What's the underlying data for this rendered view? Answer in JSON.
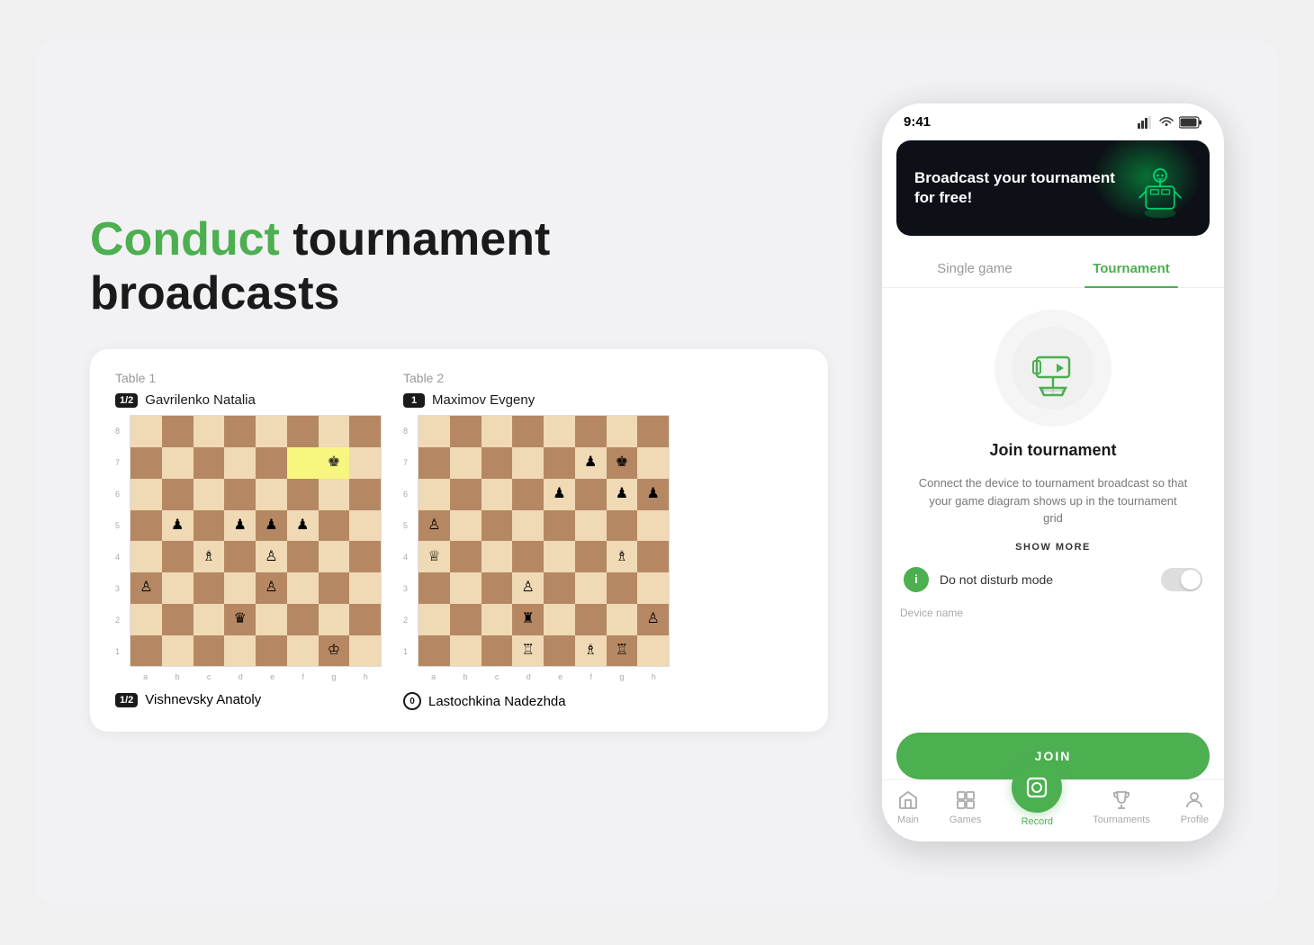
{
  "headline": {
    "green": "Conduct",
    "rest": " tournament\nbroadcasts"
  },
  "table1": {
    "label": "Table 1",
    "player1": {
      "badge": "1/2",
      "name": "Gavrilenko Natalia"
    },
    "player2": {
      "badge": "1/2",
      "name": "Vishnevsky Anatoly"
    }
  },
  "table2": {
    "label": "Table 2",
    "player1": {
      "badge": "1",
      "name": "Maximov Evgeny"
    },
    "player2": {
      "badge_type": "circle",
      "badge": "0",
      "name": "Lastochkina Nadezhda"
    }
  },
  "phone": {
    "status_time": "9:41",
    "banner_text": "Broadcast your tournament\nfor free!",
    "tab_single": "Single game",
    "tab_tournament": "Tournament",
    "join_title": "Join tournament",
    "join_desc": "Connect the device to tournament broadcast so that your game diagram shows up in the tournament grid",
    "show_more": "SHOW MORE",
    "toggle_label": "Do not disturb mode",
    "device_name_label": "Device name",
    "join_button": "JOIN",
    "nav": {
      "main": "Main",
      "games": "Games",
      "record": "Record",
      "tournaments": "Tournaments",
      "profile": "Profile"
    }
  }
}
